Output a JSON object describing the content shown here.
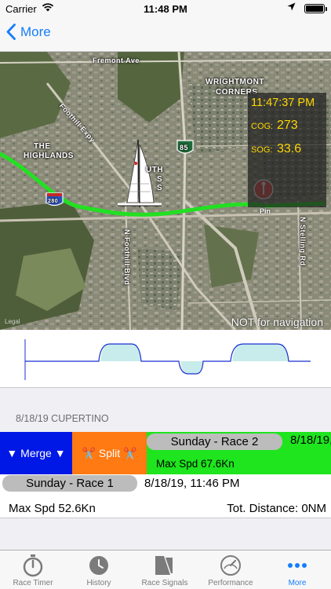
{
  "status_bar": {
    "carrier": "Carrier",
    "time": "11:48 PM"
  },
  "nav": {
    "back_label": "More"
  },
  "map": {
    "labels": {
      "fremont_ave": "Fremont Ave",
      "wrightmont": "WRIGHTMONT",
      "corners": "CORNERS",
      "foothill_expy": "Foothill Expy",
      "the": "THE",
      "highlands": "HIGHLANDS",
      "south_frag": "UTH",
      "south_frag2": "S",
      "south_frag3": "S",
      "hwy_85": "85",
      "hwy_280": "280",
      "foothill_blvd": "N Foothill Blvd",
      "stelling": "N Stelling Rd",
      "pin": "Pin",
      "legal": "Legal"
    },
    "readout": {
      "time": "11:47:37 PM",
      "cog_label": "COG:",
      "cog_value": "273",
      "sog_label": "SOG:",
      "sog_value": "33.6"
    },
    "disclaimer": "NOT for navigation",
    "colors": {
      "track": "#22e022",
      "readout_text": "#ffd700",
      "pin": "#ef5350"
    }
  },
  "speed_profile": {
    "colors": {
      "line": "#1a2fd1",
      "fill": "#c8ecec"
    }
  },
  "list": {
    "section_header": "8/18/19 CUPERTINO",
    "actions": {
      "merge_label": "▼ Merge ▼",
      "split_label": "✂️ Split ✂️"
    },
    "races": [
      {
        "name": "Sunday - Race 2",
        "date": "8/18/19,",
        "max_speed": "Max Spd  67.6Kn"
      },
      {
        "name": "Sunday - Race 1",
        "date": "8/18/19, 11:46 PM",
        "max_speed": "Max Spd  52.6Kn",
        "distance": "Tot. Distance: 0NM"
      }
    ],
    "colors": {
      "merge": "#0018e6",
      "split": "#ff7a12",
      "highlight": "#1ee51e"
    }
  },
  "tab_bar": {
    "tabs": [
      {
        "label": "Race Timer",
        "icon": "stopwatch-icon"
      },
      {
        "label": "History",
        "icon": "clock-icon"
      },
      {
        "label": "Race Signals",
        "icon": "flag-icon"
      },
      {
        "label": "Performance",
        "icon": "gauge-icon"
      },
      {
        "label": "More",
        "icon": "more-dots-icon",
        "active": true
      }
    ],
    "accent": "#157efb"
  }
}
